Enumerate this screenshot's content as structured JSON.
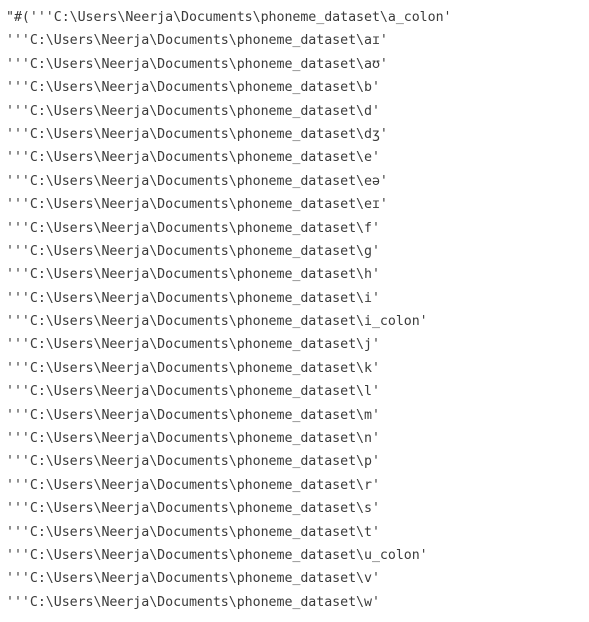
{
  "output": {
    "lines": [
      "\"#('''C:\\Users\\Neerja\\Documents\\phoneme_dataset\\a_colon'",
      "'''C:\\Users\\Neerja\\Documents\\phoneme_dataset\\aɪ'",
      "'''C:\\Users\\Neerja\\Documents\\phoneme_dataset\\aʊ'",
      "'''C:\\Users\\Neerja\\Documents\\phoneme_dataset\\b'",
      "'''C:\\Users\\Neerja\\Documents\\phoneme_dataset\\d'",
      "'''C:\\Users\\Neerja\\Documents\\phoneme_dataset\\dʒ'",
      "'''C:\\Users\\Neerja\\Documents\\phoneme_dataset\\e'",
      "'''C:\\Users\\Neerja\\Documents\\phoneme_dataset\\eə'",
      "'''C:\\Users\\Neerja\\Documents\\phoneme_dataset\\eɪ'",
      "'''C:\\Users\\Neerja\\Documents\\phoneme_dataset\\f'",
      "'''C:\\Users\\Neerja\\Documents\\phoneme_dataset\\g'",
      "'''C:\\Users\\Neerja\\Documents\\phoneme_dataset\\h'",
      "'''C:\\Users\\Neerja\\Documents\\phoneme_dataset\\i'",
      "'''C:\\Users\\Neerja\\Documents\\phoneme_dataset\\i_colon'",
      "'''C:\\Users\\Neerja\\Documents\\phoneme_dataset\\j'",
      "'''C:\\Users\\Neerja\\Documents\\phoneme_dataset\\k'",
      "'''C:\\Users\\Neerja\\Documents\\phoneme_dataset\\l'",
      "'''C:\\Users\\Neerja\\Documents\\phoneme_dataset\\m'",
      "'''C:\\Users\\Neerja\\Documents\\phoneme_dataset\\n'",
      "'''C:\\Users\\Neerja\\Documents\\phoneme_dataset\\p'",
      "'''C:\\Users\\Neerja\\Documents\\phoneme_dataset\\r'",
      "'''C:\\Users\\Neerja\\Documents\\phoneme_dataset\\s'",
      "'''C:\\Users\\Neerja\\Documents\\phoneme_dataset\\t'",
      "'''C:\\Users\\Neerja\\Documents\\phoneme_dataset\\u_colon'",
      "'''C:\\Users\\Neerja\\Documents\\phoneme_dataset\\v'",
      "'''C:\\Users\\Neerja\\Documents\\phoneme_dataset\\w'"
    ]
  },
  "colors": {
    "background": "#ffffff",
    "text": "#3b3b3b"
  }
}
